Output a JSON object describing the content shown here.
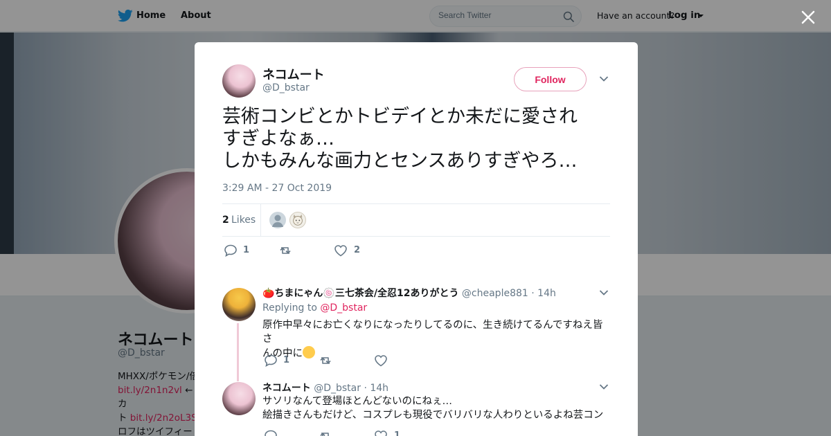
{
  "nav": {
    "home": "Home",
    "about": "About",
    "search_placeholder": "Search Twitter",
    "have_account": "Have an account?",
    "login": "Log in"
  },
  "profile": {
    "name": "ネコムート",
    "handle": "@D_bstar",
    "bio_line1": "MHXX/ポケモン/倍",
    "bio_link1": "bit.ly/2n1n2vl",
    "bio_after1": " ←カ",
    "bio_line2_prefix": "ト ",
    "bio_link2": "bit.ly/2n2oL3S",
    "bio_line3": "ロフはツイフィー"
  },
  "tweet": {
    "author_name": "ネコムート",
    "author_handle": "@D_bstar",
    "follow_label": "Follow",
    "text": "芸術コンビとかトビデイとか未だに愛され\nすぎよなぁ…\nしかもみんな画力とセンスありすぎやろ…",
    "timestamp": "3:29 AM - 27 Oct 2019",
    "likes_count": "2",
    "likes_label": "Likes",
    "reply_count": "1",
    "like_count": "2"
  },
  "replies": [
    {
      "name": "🍅ちまにゃん🍥三七茶会/全忍12ありがとう",
      "handle": "@cheaple881",
      "age": "14h",
      "replying_prefix": "Replying to ",
      "replying_to": "@D_bstar",
      "text": "原作中早々にお亡くなりになったりしてるのに、生き続けてるんですねえ皆さ\nんの中に",
      "reply_count": "1",
      "like_count": ""
    },
    {
      "name": "ネコムート",
      "handle": "@D_bstar",
      "age": "14h",
      "text": "サソリなんて登場ほとんどないのにねぇ…\n絵描きさんもだけど、コスプレも現役でバリバリな人わりといるよね芸コン",
      "reply_count": "",
      "like_count": "1"
    }
  ],
  "colors": {
    "accent": "#e0245e",
    "twitter_blue": "#1da1f2",
    "muted": "#657786"
  }
}
